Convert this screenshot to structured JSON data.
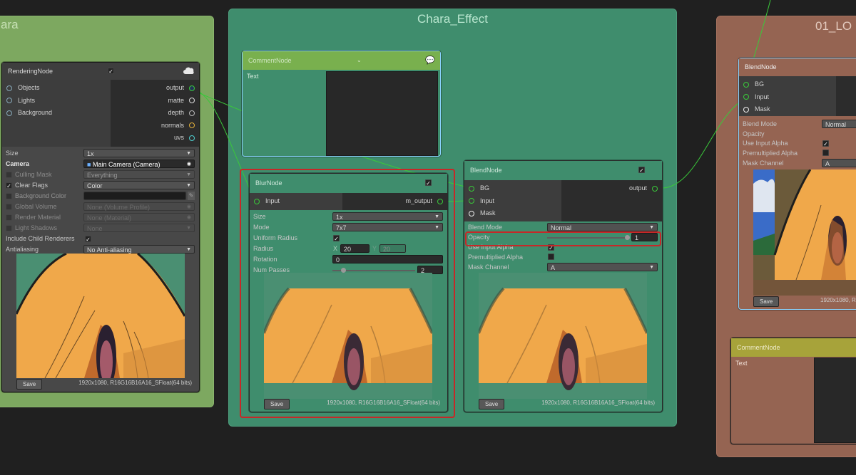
{
  "colors": {
    "background": "#202020",
    "group_green": "#7da860",
    "group_teal": "#3f8d6d",
    "group_salmon": "#956452",
    "comment_header": "#79b04e",
    "comment_header_olive": "#a7a33a",
    "edge_green": "#3ac93a",
    "highlight_red": "#c62828"
  },
  "groups": {
    "left": {
      "title": "ara"
    },
    "center": {
      "title": "Chara_Effect"
    },
    "right": {
      "title": "01_LO"
    }
  },
  "rendering_node": {
    "title": "RenderingNode",
    "enabled": true,
    "header_icon": "cloud-icon",
    "inputs": [
      "Objects",
      "Lights",
      "Background"
    ],
    "outputs": [
      "output",
      "matte",
      "depth",
      "normals",
      "uvs"
    ],
    "fields": {
      "size_label": "Size",
      "size_value": "1x",
      "camera_label": "Camera",
      "camera_value": "Main Camera (Camera)",
      "culling_label": "Culling Mask",
      "culling_value": "Everything",
      "clear_label": "Clear Flags",
      "clear_value": "Color",
      "bgcolor_label": "Background Color",
      "volume_label": "Global Volume",
      "volume_value": "None (Volume Profile)",
      "material_label": "Render Material",
      "material_value": "None (Material)",
      "shadows_label": "Light Shadows",
      "shadows_value": "None",
      "child_label": "Include Child Renderers",
      "aa_label": "Antialiasing",
      "aa_value": "No Anti-aliasing"
    },
    "save_label": "Save",
    "resolution": "1920x1080, R16G16B16A16_SFloat(64 bits)"
  },
  "comment_node_center": {
    "title": "CommentNode",
    "text_label": "Text"
  },
  "blur_node": {
    "title": "BlurNode",
    "enabled": true,
    "input": "Input",
    "output": "m_output",
    "size_label": "Size",
    "size_value": "1x",
    "mode_label": "Mode",
    "mode_value": "7x7",
    "uniform_label": "Uniform Radius",
    "radius_label": "Radius",
    "radius_x_label": "X",
    "radius_x": "20",
    "radius_y_label": "Y",
    "radius_y": "20",
    "rotation_label": "Rotation",
    "rotation_value": "0",
    "passes_label": "Num Passes",
    "passes_value": "2",
    "save_label": "Save",
    "resolution": "1920x1080, R16G16B16A16_SFloat(64 bits)"
  },
  "blend_node_center": {
    "title": "BlendNode",
    "enabled": true,
    "inputs": [
      "BG",
      "Input",
      "Mask"
    ],
    "output": "output",
    "mode_label": "Blend Mode",
    "mode_value": "Normal",
    "opacity_label": "Opacity",
    "opacity_value": "1",
    "use_alpha_label": "Use Input Alpha",
    "premult_label": "Premultiplied Alpha",
    "mask_label": "Mask Channel",
    "mask_value": "A",
    "save_label": "Save",
    "resolution": "1920x1080, R16G16B16A16_SFloat(64 bits)"
  },
  "blend_node_right": {
    "title": "BlendNode",
    "inputs": [
      "BG",
      "Input",
      "Mask"
    ],
    "mode_label": "Blend Mode",
    "mode_value": "Normal",
    "opacity_label": "Opacity",
    "use_alpha_label": "Use Input Alpha",
    "premult_label": "Premultiplied Alpha",
    "mask_label": "Mask Channel",
    "mask_value": "A",
    "save_label": "Save",
    "resolution": "1920x1080, R"
  },
  "comment_node_right": {
    "title": "CommentNode",
    "text_label": "Text"
  }
}
